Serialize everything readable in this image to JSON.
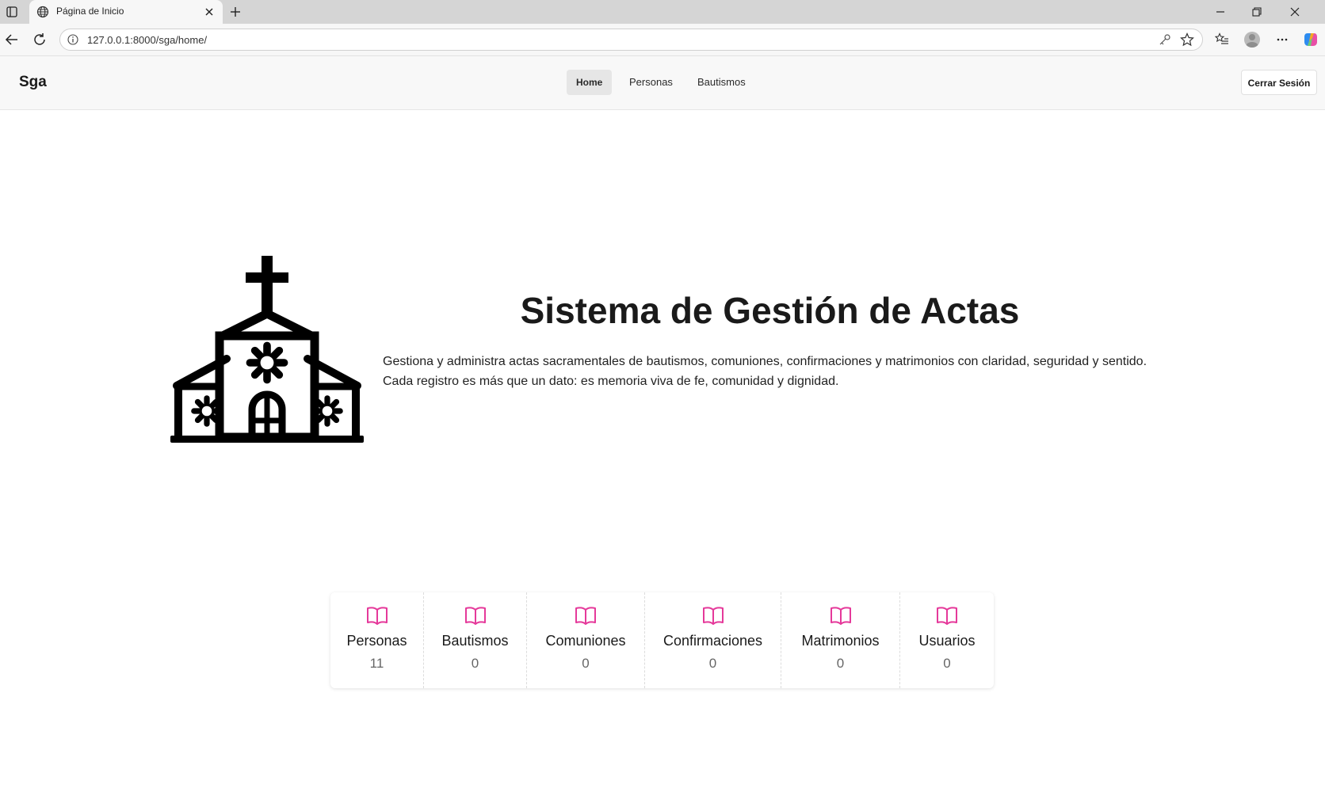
{
  "browser": {
    "tab_title": "Página de Inicio",
    "url": "127.0.0.1:8000/sga/home/"
  },
  "navbar": {
    "brand": "Sga",
    "links": [
      "Home",
      "Personas",
      "Bautismos"
    ],
    "active_link": "Home",
    "logout_label": "Cerrar Sesión"
  },
  "hero": {
    "title": "Sistema de Gestión de Actas",
    "line1": "Gestiona y administra actas sacramentales de bautismos, comuniones, confirmaciones y matrimonios con claridad, seguridad y sentido.",
    "line2": "Cada registro es más que un dato: es memoria viva de fe, comunidad y dignidad.",
    "icon": "church-icon"
  },
  "stats": [
    {
      "label": "Personas",
      "value": "11",
      "icon": "book-icon"
    },
    {
      "label": "Bautismos",
      "value": "0",
      "icon": "book-icon"
    },
    {
      "label": "Comuniones",
      "value": "0",
      "icon": "book-icon"
    },
    {
      "label": "Confirmaciones",
      "value": "0",
      "icon": "book-icon"
    },
    {
      "label": "Matrimonios",
      "value": "0",
      "icon": "book-icon"
    },
    {
      "label": "Usuarios",
      "value": "0",
      "icon": "book-icon"
    }
  ],
  "colors": {
    "accent": "#e5399a",
    "navbar_bg": "#f8f8f8",
    "active_link_bg": "#e6e6e6"
  }
}
